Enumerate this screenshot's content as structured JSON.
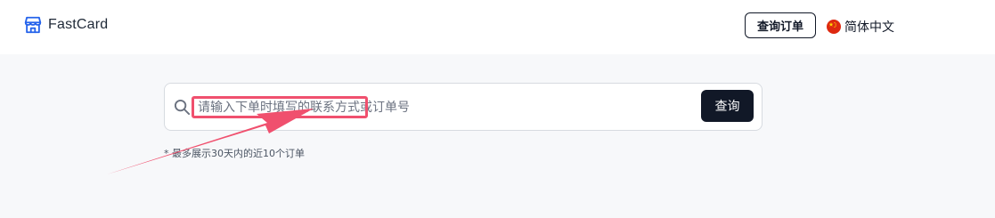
{
  "header": {
    "brand_name": "FastCard",
    "brand_icon": "storefront-icon",
    "order_query_button": "查询订单",
    "language": {
      "flag_icon": "china-flag-icon",
      "label": "简体中文"
    }
  },
  "search": {
    "icon": "search-icon",
    "placeholder": "请输入下单时填写的联系方式或订单号",
    "value": "",
    "button_label": "查询",
    "note": "* 最多展示30天内的近10个订单"
  },
  "annotation": {
    "color": "#f0506e",
    "highlight_target": "search-input",
    "arrow_icon": "pointer-arrow"
  },
  "colors": {
    "brand_icon": "#2563eb",
    "primary_button": "#111827",
    "page_background": "#f7f8fa",
    "flag_red": "#de2910",
    "flag_star": "#ffde00"
  }
}
